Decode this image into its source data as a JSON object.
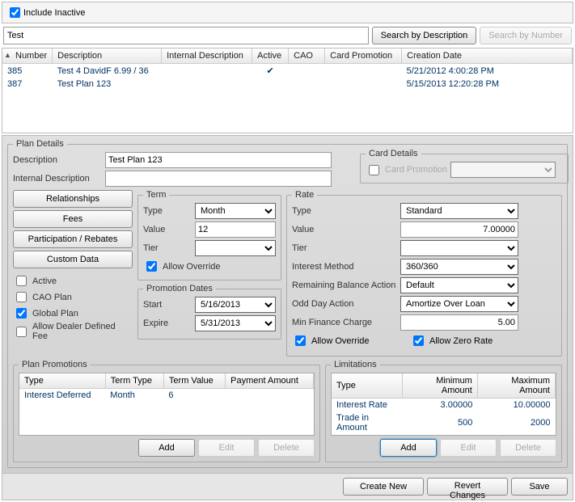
{
  "topbar": {
    "include_inactive_label": "Include Inactive",
    "include_inactive_checked": true
  },
  "search": {
    "value": "Test",
    "by_description": "Search by Description",
    "by_number": "Search by Number"
  },
  "results": {
    "headers": {
      "number": "Number",
      "description": "Description",
      "internal": "Internal Description",
      "active": "Active",
      "cao": "CAO",
      "card_promo": "Card Promotion",
      "created": "Creation Date"
    },
    "rows": [
      {
        "number": "385",
        "description": "Test 4 DavidF 6.99 / 36",
        "internal": "",
        "active": "✔",
        "cao": "",
        "card_promo": "",
        "created": "5/21/2012 4:00:28 PM"
      },
      {
        "number": "387",
        "description": "Test Plan 123",
        "internal": "",
        "active": "",
        "cao": "",
        "card_promo": "",
        "created": "5/15/2013 12:20:28 PM"
      }
    ]
  },
  "plan_details": {
    "legend": "Plan Details",
    "description_label": "Description",
    "description_value": "Test Plan 123",
    "internal_label": "Internal Description",
    "internal_value": ""
  },
  "card_details": {
    "legend": "Card Details",
    "promotion_label": "Card Promotion",
    "promotion_checked": false
  },
  "left_buttons": {
    "relationships": "Relationships",
    "fees": "Fees",
    "participation": "Participation / Rebates",
    "custom_data": "Custom Data"
  },
  "left_checks": {
    "active": "Active",
    "cao": "CAO Plan",
    "global": "Global Plan",
    "dealer": "Allow Dealer Defined Fee",
    "active_checked": false,
    "cao_checked": false,
    "global_checked": true,
    "dealer_checked": false
  },
  "term": {
    "legend": "Term",
    "type_label": "Type",
    "type_value": "Month",
    "value_label": "Value",
    "value_value": "12",
    "tier_label": "Tier",
    "tier_value": "",
    "override_label": "Allow Override",
    "override_checked": true
  },
  "promo_dates": {
    "legend": "Promotion Dates",
    "start_label": "Start",
    "start_value": "5/16/2013",
    "expire_label": "Expire",
    "expire_value": "5/31/2013"
  },
  "rate": {
    "legend": "Rate",
    "type_label": "Type",
    "type_value": "Standard",
    "value_label": "Value",
    "value_value": "7.00000",
    "tier_label": "Tier",
    "tier_value": "",
    "interest_label": "Interest Method",
    "interest_value": "360/360",
    "balance_label": "Remaining Balance Action",
    "balance_value": "Default",
    "odd_label": "Odd Day Action",
    "odd_value": "Amortize Over Loan",
    "min_label": "Min Finance Charge",
    "min_value": "5.00",
    "override_label": "Allow Override",
    "override_checked": true,
    "zero_label": "Allow Zero Rate",
    "zero_checked": true
  },
  "promotions": {
    "legend": "Plan Promotions",
    "headers": {
      "type": "Type",
      "term_type": "Term Type",
      "term_value": "Term Value",
      "payment": "Payment Amount"
    },
    "rows": [
      {
        "type": "Interest Deferred",
        "term_type": "Month",
        "term_value": "6",
        "payment": ""
      }
    ]
  },
  "limitations": {
    "legend": "Limitations",
    "headers": {
      "type": "Type",
      "min": "Minimum Amount",
      "max": "Maximum Amount"
    },
    "rows": [
      {
        "type": "Interest Rate",
        "min": "3.00000",
        "max": "10.00000"
      },
      {
        "type": "Trade in Amount",
        "min": "500",
        "max": "2000"
      }
    ]
  },
  "buttons": {
    "add": "Add",
    "edit": "Edit",
    "delete": "Delete"
  },
  "footer": {
    "create": "Create New",
    "revert": "Revert Changes",
    "save": "Save"
  }
}
